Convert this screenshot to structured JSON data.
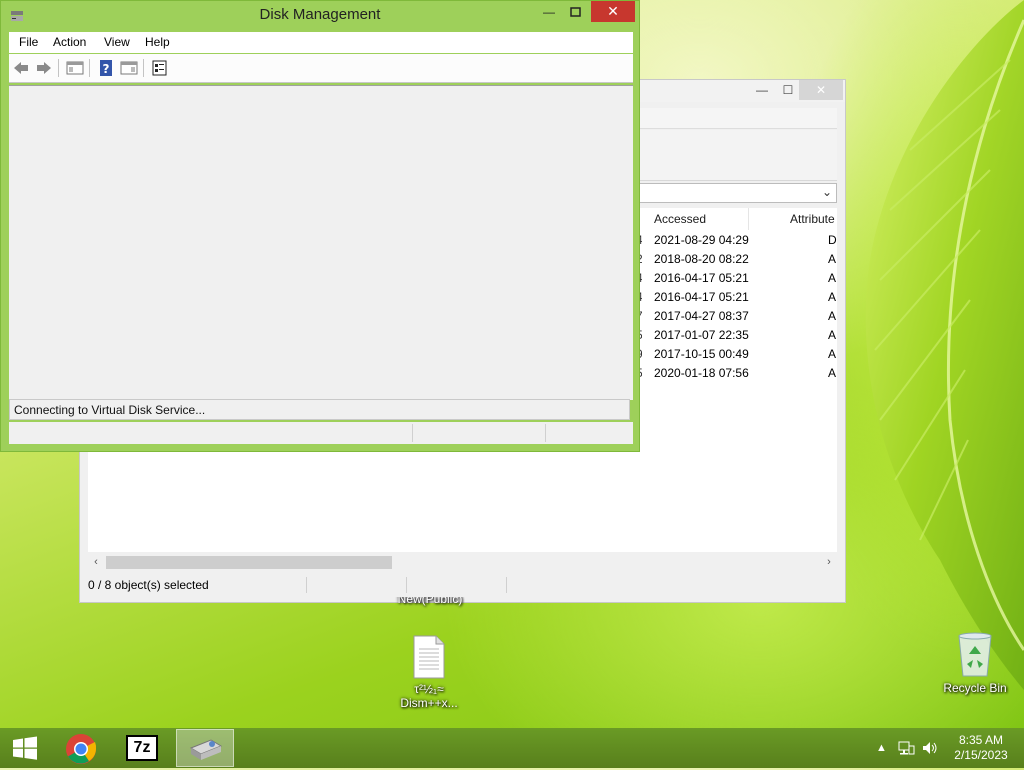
{
  "disk_management": {
    "title": "Disk Management",
    "menu": [
      "File",
      "Action",
      "View",
      "Help"
    ],
    "connecting_message": "Connecting to Virtual Disk Service...",
    "buttons": {
      "minimize": "—",
      "maximize": "☐",
      "close": "✕"
    }
  },
  "explorer": {
    "columns": {
      "accessed": "Accessed",
      "attributes": "Attribute"
    },
    "rows": [
      {
        "prev": "4",
        "accessed": "2021-08-29 04:29",
        "attr": "D"
      },
      {
        "prev": "2",
        "accessed": "2018-08-20 08:22",
        "attr": "A"
      },
      {
        "prev": "4",
        "accessed": "2016-04-17 05:21",
        "attr": "A"
      },
      {
        "prev": "4",
        "accessed": "2016-04-17 05:21",
        "attr": "A"
      },
      {
        "prev": "7",
        "accessed": "2017-04-27 08:37",
        "attr": "A"
      },
      {
        "prev": "5",
        "accessed": "2017-01-07 22:35",
        "attr": "A"
      },
      {
        "prev": "9",
        "accessed": "2017-10-15 00:49",
        "attr": "A"
      },
      {
        "prev": "5",
        "accessed": "2020-01-18 07:56",
        "attr": "A"
      }
    ],
    "status": "0 / 8 object(s) selected",
    "buttons": {
      "minimize": "—",
      "maximize": "☐",
      "close": "✕"
    }
  },
  "desktop": {
    "partial_label": "New(Public)",
    "file_icon_label_line1": "τ²½₁≈",
    "file_icon_label_line2": "Dism++x...",
    "recycle_bin": "Recycle Bin"
  },
  "taskbar": {
    "time": "8:35 AM",
    "date": "2/15/2023",
    "apps": [
      "start-icon",
      "chrome-icon",
      "7zip-icon",
      "disk-management-icon"
    ],
    "sevenzip_label": "7z"
  }
}
